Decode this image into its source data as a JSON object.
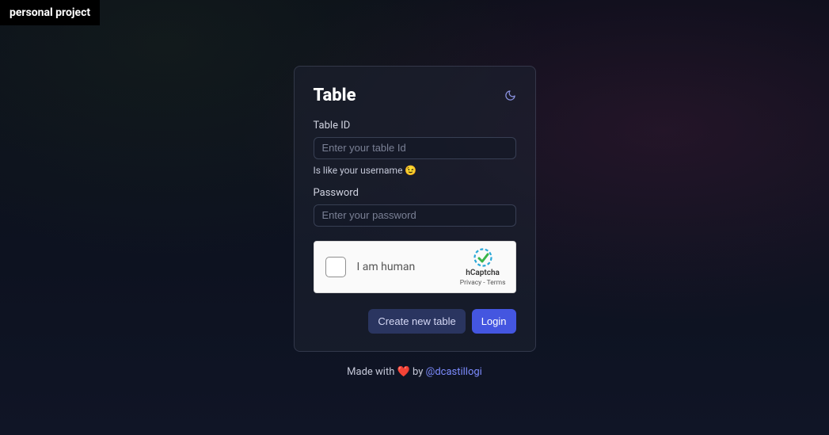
{
  "badge": {
    "label": "personal project"
  },
  "card": {
    "title": "Table",
    "table_id": {
      "label": "Table ID",
      "placeholder": "Enter your table Id",
      "hint": "Is like your username 😉"
    },
    "password": {
      "label": "Password",
      "placeholder": "Enter your password"
    },
    "captcha": {
      "label": "I am human",
      "brand": "hCaptcha",
      "privacy": "Privacy",
      "sep": " - ",
      "terms": "Terms"
    },
    "actions": {
      "create": "Create new table",
      "login": "Login"
    }
  },
  "footer": {
    "prefix": "Made with ",
    "heart": "❤️",
    "by": " by ",
    "handle": "@dcastillogi"
  }
}
